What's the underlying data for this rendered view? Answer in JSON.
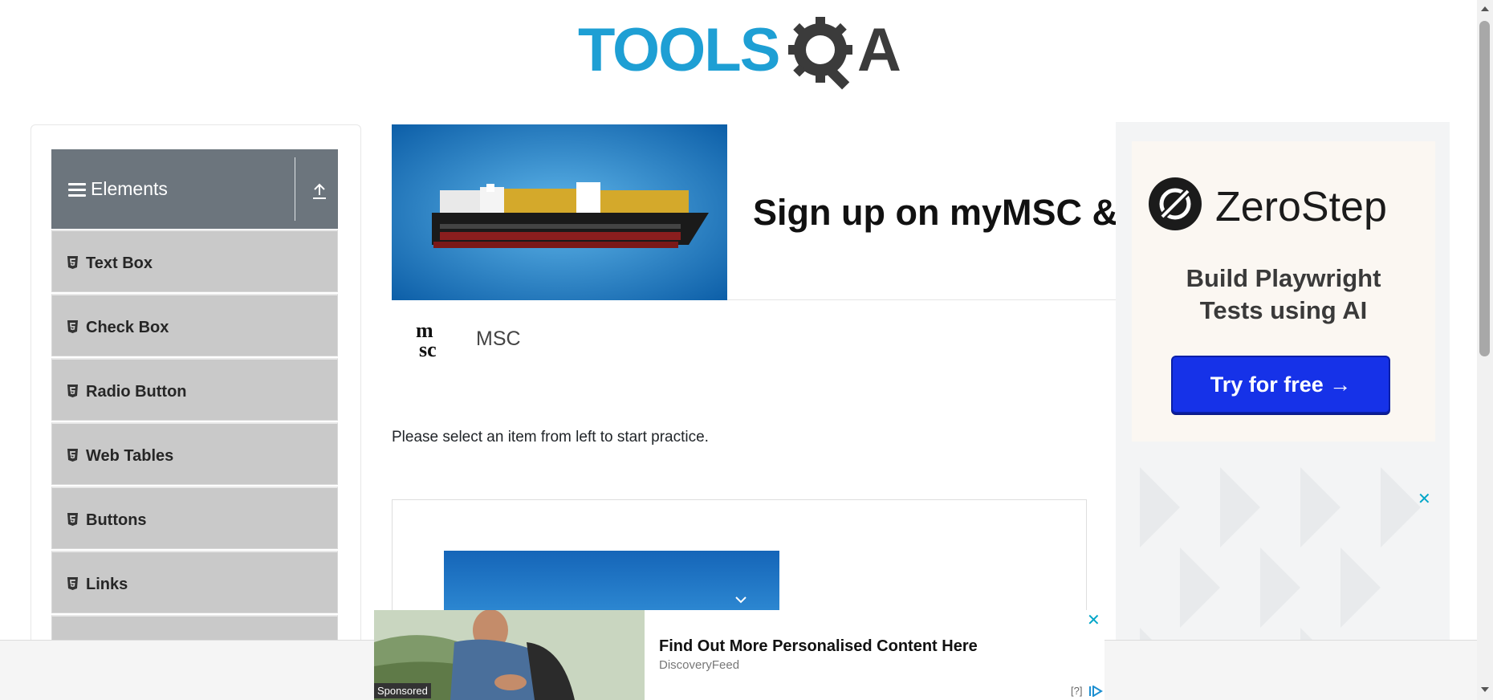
{
  "header": {
    "logo_text": "TOOLSQA",
    "logo_icon": "gear-magnifier-icon"
  },
  "sidebar": {
    "group_title": "Elements",
    "group_icons": {
      "menu": "hamburger-icon",
      "collapse": "upload-arrow-icon"
    },
    "items": [
      {
        "label": "Text Box",
        "icon": "html5-icon"
      },
      {
        "label": "Check Box",
        "icon": "html5-icon"
      },
      {
        "label": "Radio Button",
        "icon": "html5-icon"
      },
      {
        "label": "Web Tables",
        "icon": "html5-icon"
      },
      {
        "label": "Buttons",
        "icon": "html5-icon"
      },
      {
        "label": "Links",
        "icon": "html5-icon"
      }
    ]
  },
  "main": {
    "banner_ad": {
      "title": "Sign up on myMSC & B",
      "brand": "MSC",
      "brand_logo": "msc-logo"
    },
    "practice_text": "Please select an item from left to start practice."
  },
  "right_ad": {
    "brand": "ZeroStep",
    "tagline_line1": "Build Playwright",
    "tagline_line2": "Tests using AI",
    "cta": "Try for free →",
    "close": "✕"
  },
  "bottom_ad": {
    "title": "Find Out More Personalised Content Here",
    "source": "DiscoveryFeed",
    "sponsored": "Sponsored",
    "info": "[?]",
    "close": "✕"
  },
  "colors": {
    "brand_blue": "#1e9fd4",
    "sidebar_header": "#6c757d",
    "menu_item_bg": "#c9c9c9",
    "cta_blue": "#1632e8",
    "close_teal": "#00a6c8"
  }
}
